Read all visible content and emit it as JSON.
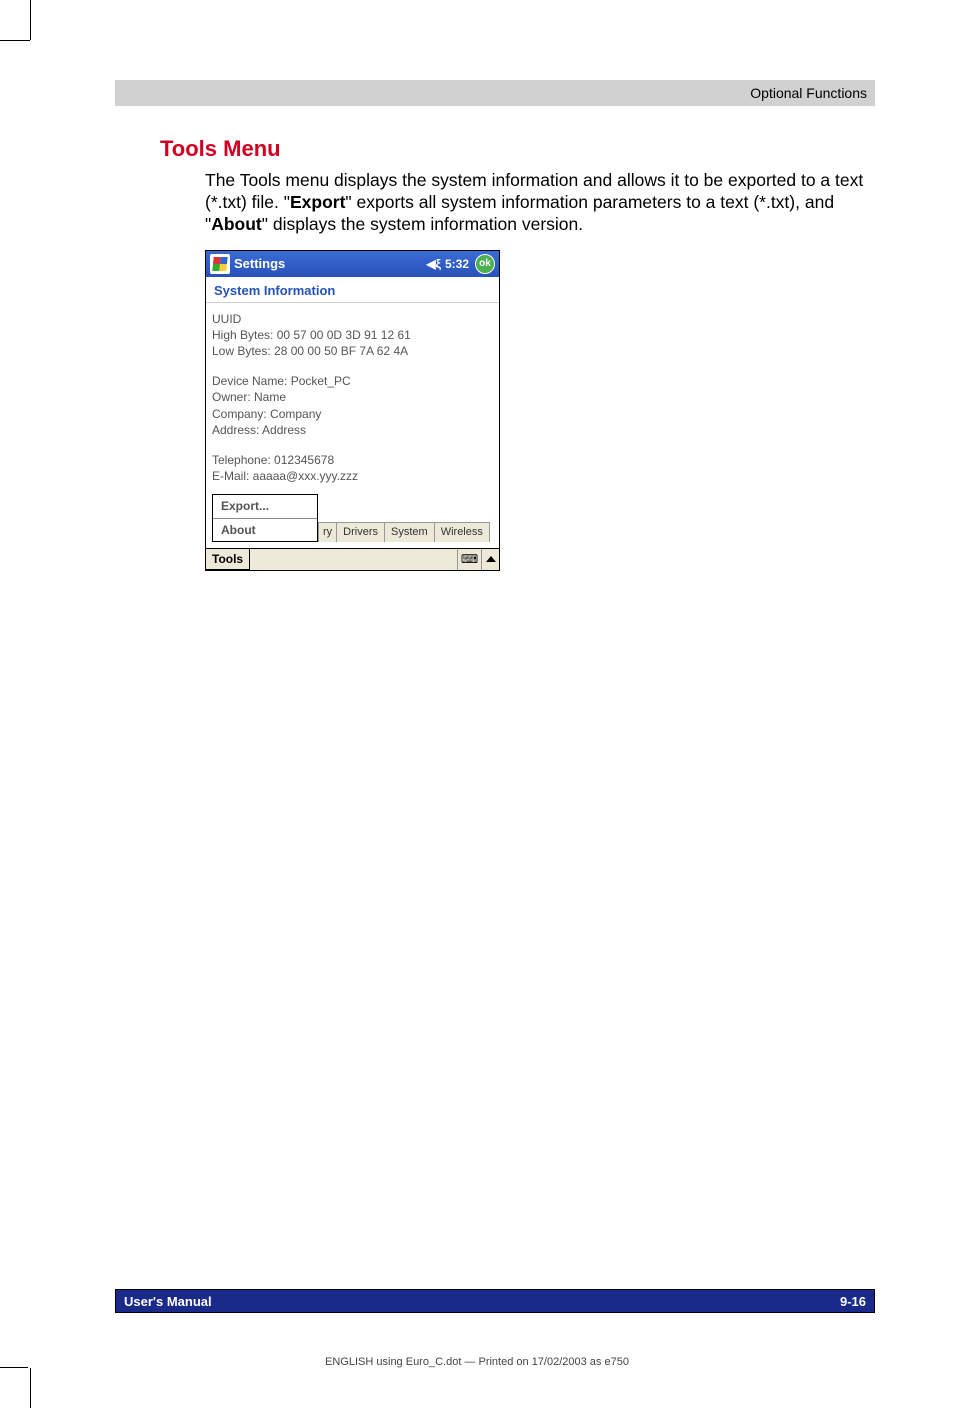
{
  "header": {
    "section_label": "Optional Functions"
  },
  "heading": "Tools Menu",
  "text": {
    "p1a": "The Tools menu displays the system information and allows it to be exported to a text (*.txt) file. \"",
    "p1_export": "Export",
    "p1b": "\" exports all system information parameters to a text (*.txt), and \"",
    "p1_about": "About",
    "p1c": "\" displays the system information version."
  },
  "screenshot": {
    "titlebar": {
      "title": "Settings",
      "time": "5:32",
      "ok": "ok"
    },
    "subtitle": "System Information",
    "uuid": {
      "label": "UUID",
      "high": "High Bytes: 00 57 00 0D 3D 91 12 61",
      "low": "Low Bytes: 28 00 00 50 BF 7A 62 4A"
    },
    "device": {
      "name": "Device Name: Pocket_PC",
      "owner": "Owner: Name",
      "company": "Company: Company",
      "address": "Address: Address"
    },
    "contact": {
      "tel": "Telephone: 012345678",
      "email": "E-Mail: aaaaa@xxx.yyy.zzz"
    },
    "menu": {
      "export": "Export...",
      "about": "About"
    },
    "tabs": {
      "ry": "ry",
      "drivers": "Drivers",
      "system": "System",
      "wireless": "Wireless"
    },
    "taskbar": {
      "tools": "Tools",
      "kbd": "⌨"
    }
  },
  "footer": {
    "left": "User's Manual",
    "right": "9-16"
  },
  "printline": "ENGLISH using Euro_C.dot — Printed on 17/02/2003 as e750"
}
